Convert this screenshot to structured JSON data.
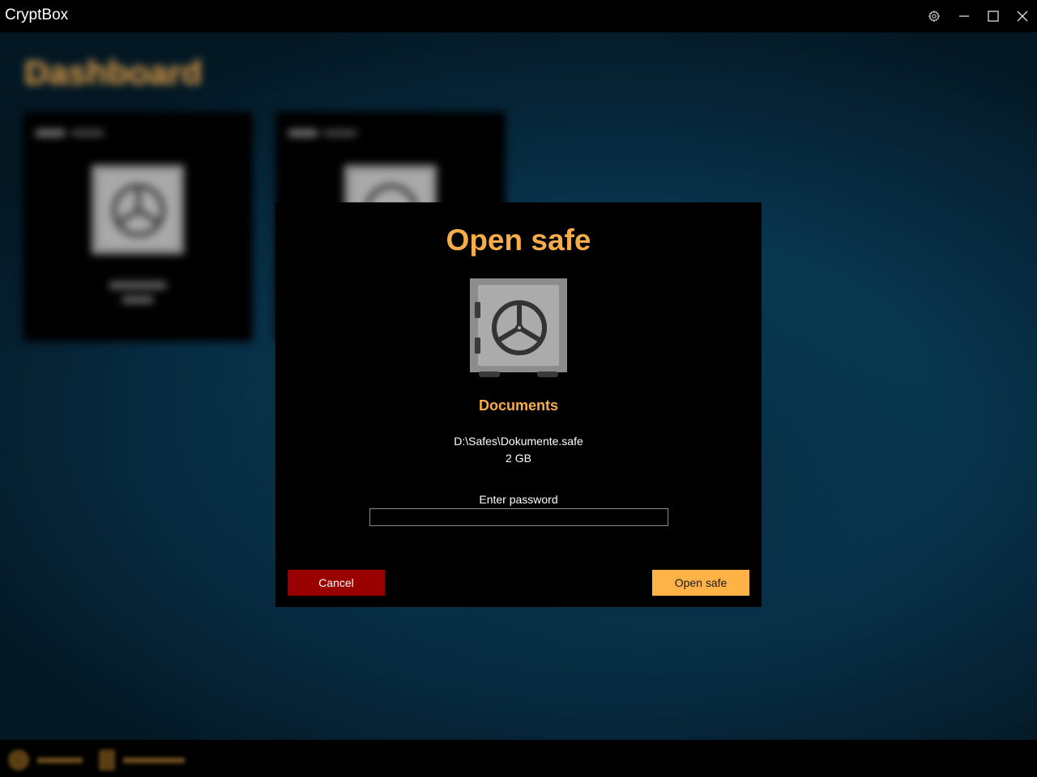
{
  "window": {
    "title": "CryptBox"
  },
  "titlebar_icons": [
    "gear-icon",
    "minimize-icon",
    "maximize-icon",
    "close-icon"
  ],
  "dashboard": {
    "title": "Dashboard"
  },
  "dialog": {
    "title": "Open safe",
    "safe_name": "Documents",
    "safe_path": "D:\\Safes\\Dokumente.safe",
    "safe_size": "2 GB",
    "password_label": "Enter password",
    "password_value": "",
    "cancel_label": "Cancel",
    "open_label": "Open safe"
  },
  "colors": {
    "accent": "#f7ac4a",
    "cancel": "#990000",
    "open_button": "#ffb347",
    "dialog_bg": "#000000",
    "app_bg": "#0a4868"
  }
}
